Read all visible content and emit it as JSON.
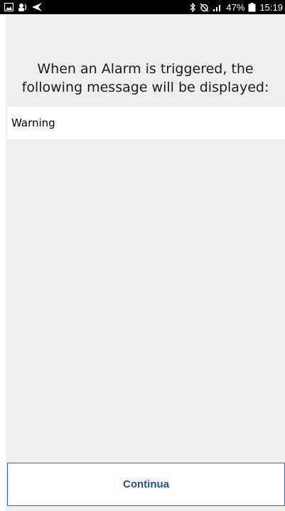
{
  "status_bar": {
    "icons_left": [
      "image-icon",
      "people-icon",
      "send-icon"
    ],
    "icons_right": [
      "bluetooth-icon",
      "alarm-off-icon",
      "signal-icon"
    ],
    "battery": "47%",
    "time": "15:19"
  },
  "prompt": {
    "line1": "When an Alarm is triggered, the",
    "line2": "following message will be displayed:"
  },
  "message": {
    "value": "Warning"
  },
  "footer": {
    "continue_label": "Continua"
  },
  "colors": {
    "background": "#efefef",
    "accent": "#2f63b5",
    "status_bar": "#000000"
  }
}
